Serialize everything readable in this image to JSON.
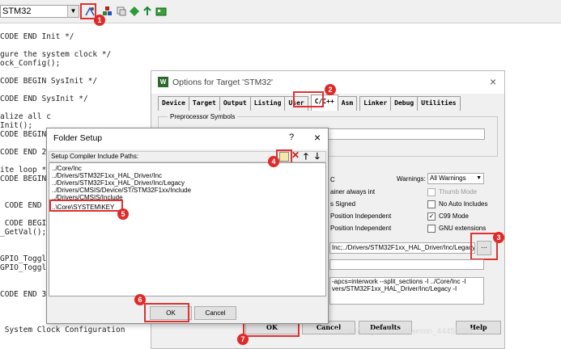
{
  "toolbar": {
    "target": "STM32",
    "icons": [
      "options-for-target-icon",
      "manage-components-icon",
      "file-extensions-icon",
      "run-time-environment-icon",
      "pack-installer-icon",
      "select-packs-icon"
    ]
  },
  "editor": {
    "lines": [
      "CODE END Init */",
      "",
      "gure the system clock */",
      "ock_Config();",
      "",
      "CODE BEGIN SysInit */",
      "",
      "CODE END SysInit */",
      "",
      "alize all c",
      "Init();",
      "CODE BEGIN",
      "",
      "CODE END 2",
      "",
      "ite loop */",
      "CODE BEGIN",
      "",
      "",
      " CODE END",
      "",
      " CODE BEGI",
      "_GetVal();",
      "",
      "",
      "GPIO_Toggle",
      "GPIO_Toggle",
      "",
      "",
      "CODE END 3",
      "",
      "",
      "",
      " System Clock Configuration"
    ]
  },
  "options_dialog": {
    "title": "Options for Target 'STM32'",
    "close": "×",
    "tabs": [
      "Device",
      "Target",
      "Output",
      "Listing",
      "User",
      "C/C++",
      "Asm",
      "Linker",
      "Debug",
      "Utilities"
    ],
    "active_tab": "C/C++",
    "preprocessor_label": "Preprocessor Symbols",
    "options_fragments": [
      "C",
      "ainer always int",
      "s Signed",
      "Position Independent",
      "Position Independent"
    ],
    "warnings_label": "Warnings:",
    "warnings_value": "All Warnings",
    "thumb_mode": "Thumb Mode",
    "no_auto_includes": "No Auto Includes",
    "c99_mode": "C99 Mode",
    "gnu_extensions": "GNU extensions",
    "include_paths": "Inc;../Drivers/STM32F1xx_HAL_Driver/Inc/Legacy;",
    "browse_label": "...",
    "compiler_control_1": "-apcs=interwork --split_sections -I ../Core/Inc -I",
    "compiler_control_2": "vers/STM32F1xx_HAL_Driver/Inc/Legacy -I",
    "buttons": {
      "ok": "OK",
      "cancel": "Cancel",
      "defaults": "Defaults",
      "help": "Help"
    }
  },
  "folder_dialog": {
    "title": "Folder Setup",
    "help": "?",
    "close": "×",
    "header_label": "Setup Compiler Include Paths:",
    "paths": [
      "../Core/Inc",
      "../Drivers/STM32F1xx_HAL_Driver/Inc",
      "../Drivers/STM32F1xx_HAL_Driver/Inc/Legacy",
      "../Drivers/CMSIS/Device/ST/STM32F1xx/Include",
      "../Drivers/CMSIS/Include",
      "..\\Core\\SYSTEM\\KEY"
    ],
    "buttons": {
      "ok": "OK",
      "cancel": "Cancel"
    }
  },
  "annotations": {
    "badges": [
      "1",
      "2",
      "3",
      "4",
      "5",
      "6",
      "7"
    ],
    "color": "#e03030"
  },
  "watermark": "https://blog.csdn.net/weixin_44453694"
}
